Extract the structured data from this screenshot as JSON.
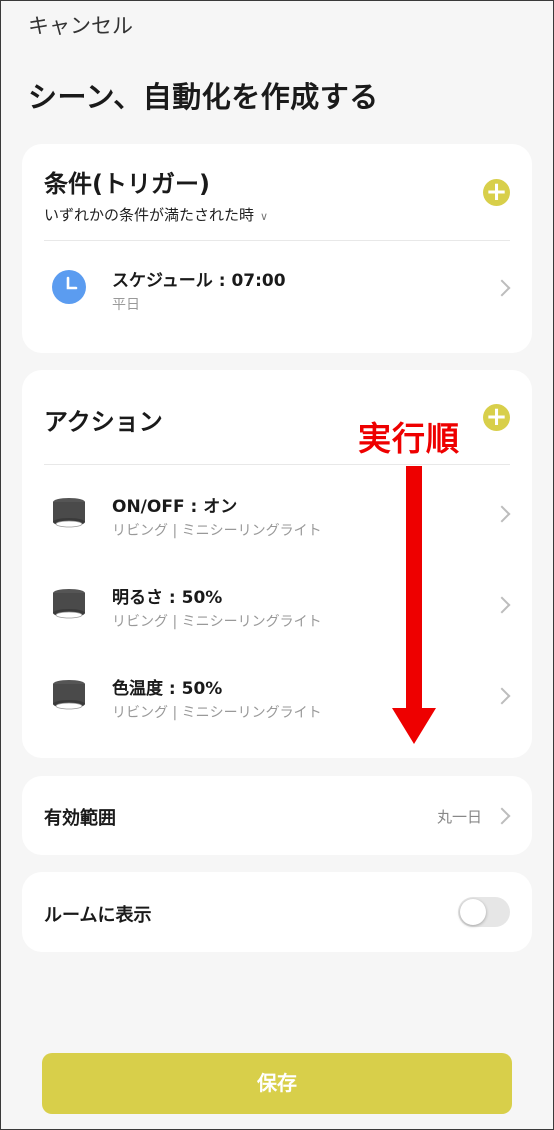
{
  "header": {
    "cancel_label": "キャンセル",
    "page_title": "シーン、自動化を作成する"
  },
  "conditions": {
    "title": "条件(トリガー)",
    "match_mode": "いずれかの条件が満たされた時",
    "add_icon": "plus-icon",
    "items": [
      {
        "icon": "clock-icon",
        "name": "スケジュール : 07:00",
        "sub": "平日"
      }
    ]
  },
  "actions": {
    "title": "アクション",
    "add_icon": "plus-icon",
    "items": [
      {
        "icon": "ceiling-light-icon",
        "name": "ON/OFF : オン",
        "sub": "リビング | ミニシーリングライト"
      },
      {
        "icon": "ceiling-light-icon",
        "name": "明るさ : 50%",
        "sub": "リビング | ミニシーリングライト"
      },
      {
        "icon": "ceiling-light-icon",
        "name": "色温度 : 50%",
        "sub": "リビング | ミニシーリングライト"
      }
    ],
    "annotation": {
      "text": "実行順",
      "color": "#ee0000"
    }
  },
  "valid_range": {
    "label": "有効範囲",
    "value": "丸一日"
  },
  "show_in_room": {
    "label": "ルームに表示",
    "enabled": false
  },
  "footer": {
    "save_label": "保存"
  },
  "colors": {
    "accent": "#d8cf4a",
    "clock": "#5b9cf0",
    "background": "#f6f6f6"
  }
}
